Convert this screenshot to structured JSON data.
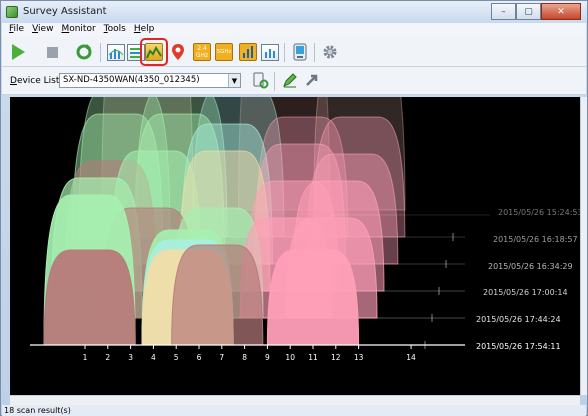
{
  "window": {
    "title": "Survey Assistant",
    "controls": [
      "–",
      "▢",
      "✕"
    ]
  },
  "menu": [
    "File",
    "View",
    "Monitor",
    "Tools",
    "Help"
  ],
  "toolbar": {
    "band_24_label": "2.4\nGHz",
    "band_5_label": "5GHz"
  },
  "device": {
    "label": "Device List :",
    "selected": "SX-ND-4350WAN(4350_012345)"
  },
  "chart_data": {
    "type": "area",
    "x_ticks": [
      "1",
      "2",
      "3",
      "4",
      "5",
      "6",
      "7",
      "8",
      "9",
      "10",
      "11",
      "12",
      "13",
      "14"
    ],
    "scans": [
      "2015/05/26 17:54:11",
      "2015/05/26 17:44:24",
      "2015/05/26 17:00:14",
      "2015/05/26 16:34:29",
      "2015/05/26 16:18:57",
      "2015/05/26 15:24:53"
    ],
    "colors": {
      "pink": "#ff9fb8",
      "beige": "#f0dca8",
      "green": "#a6f0b0",
      "cyan": "#a8f0e0",
      "rose": "#b77a7a",
      "salmon": "#e0b0a8"
    }
  },
  "status": {
    "text": "18 scan result(s)"
  }
}
